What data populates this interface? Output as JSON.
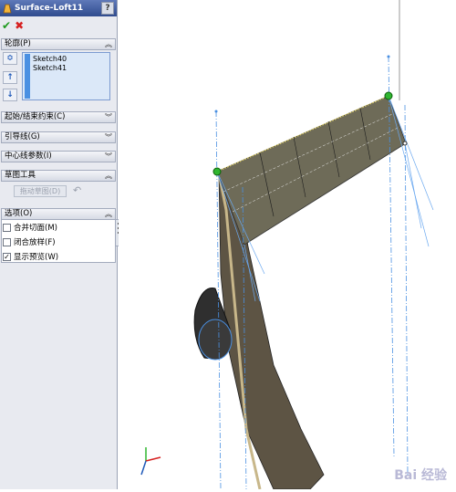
{
  "title": "Surface-Loft11",
  "help_label": "?",
  "ok_symbol": "✔",
  "cancel_symbol": "✖",
  "sections": {
    "profiles": "轮廓(P)",
    "constraints": "起始/结束约束(C)",
    "guides": "引导线(G)",
    "centerline": "中心线参数(I)",
    "sketch_tools": "草图工具",
    "options": "选项(O)"
  },
  "profile_items": [
    "Sketch40",
    "Sketch41"
  ],
  "sketch_drag_label": "拖动草图(D)",
  "options": [
    {
      "label": "合并切面(M)",
      "checked": false
    },
    {
      "label": "闭合放样(F)",
      "checked": false
    },
    {
      "label": "显示预览(W)",
      "checked": true
    }
  ],
  "colors": {
    "surface": "#6e6b58",
    "guide_line": "#4a90e2",
    "point": "#2fb52f"
  },
  "watermark": "Bai 经验"
}
